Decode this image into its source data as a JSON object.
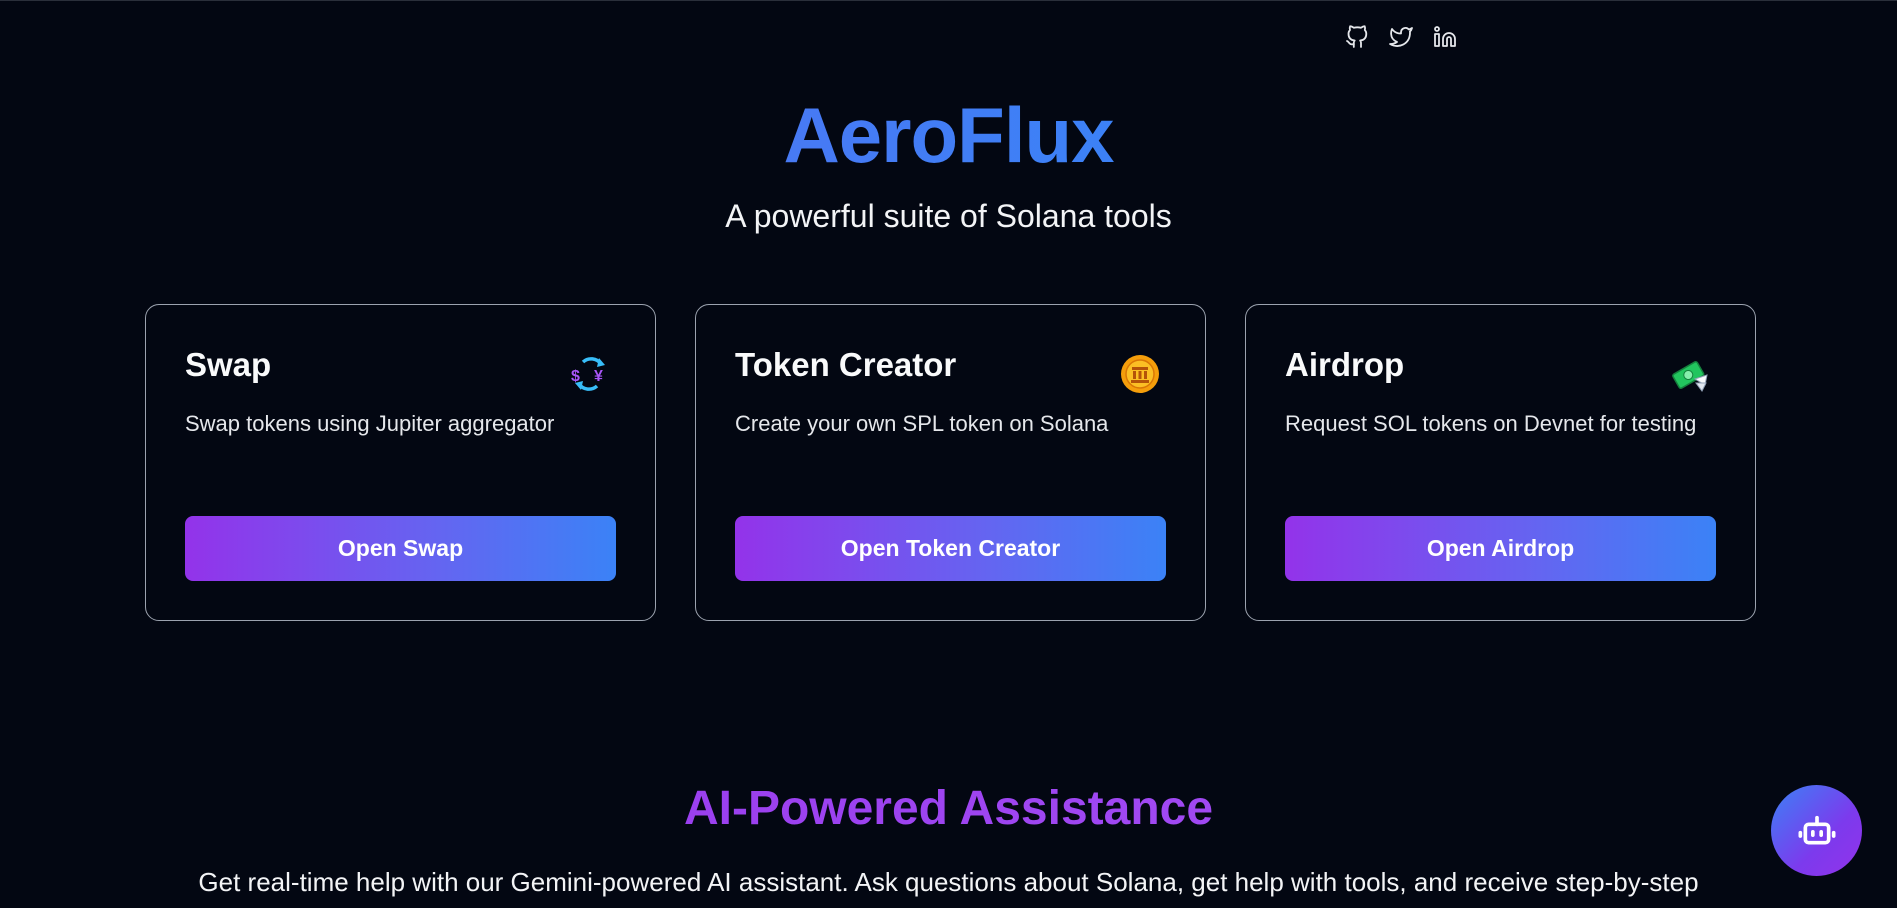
{
  "header": {
    "social_icons": [
      "github-icon",
      "twitter-icon",
      "linkedin-icon"
    ]
  },
  "hero": {
    "title": "AeroFlux",
    "subtitle": "A powerful suite of Solana tools"
  },
  "cards": [
    {
      "title": "Swap",
      "description": "Swap tokens using Jupiter aggregator",
      "icon": "currency-exchange-icon",
      "button_label": "Open Swap"
    },
    {
      "title": "Token Creator",
      "description": "Create your own SPL token on Solana",
      "icon": "coin-icon",
      "button_label": "Open Token Creator"
    },
    {
      "title": "Airdrop",
      "description": "Request SOL tokens on Devnet for testing",
      "icon": "money-with-wings-icon",
      "button_label": "Open Airdrop"
    }
  ],
  "ai_section": {
    "title": "AI-Powered Assistance",
    "description": "Get real-time help with our Gemini-powered AI assistant. Ask questions about Solana, get help with tools, and receive step-by-step"
  },
  "chat_button": {
    "icon": "robot-icon"
  },
  "colors": {
    "background": "#030712",
    "accent_purple": "#9333ea",
    "accent_blue": "#3b82f6",
    "card_border": "#9ca3af"
  }
}
